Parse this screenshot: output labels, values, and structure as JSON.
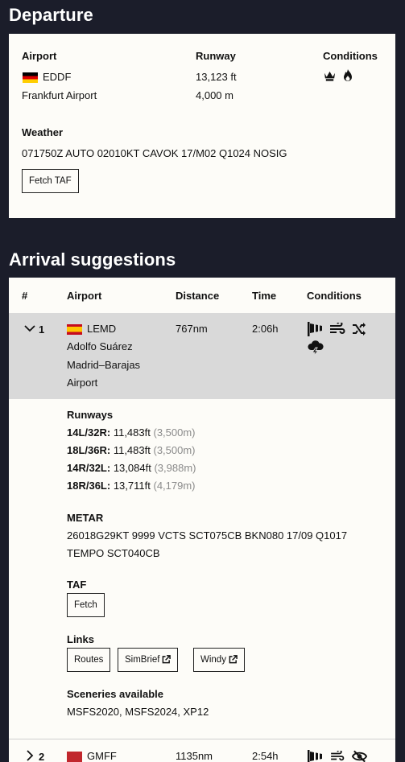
{
  "departure": {
    "section_title": "Departure",
    "airport_label": "Airport",
    "icao": "EDDF",
    "airport_name": "Frankfurt Airport",
    "runway_label": "Runway",
    "runway_ft": "13,123 ft",
    "runway_m": "4,000 m",
    "conditions_label": "Conditions",
    "condition_icons": [
      "crown-icon",
      "fire-icon"
    ],
    "weather_label": "Weather",
    "metar": "071750Z AUTO 02010KT CAVOK 17/M02 Q1024 NOSIG",
    "fetch_taf_label": "Fetch TAF"
  },
  "arrivals": {
    "section_title": "Arrival suggestions",
    "headers": {
      "num": "#",
      "airport": "Airport",
      "distance": "Distance",
      "time": "Time",
      "conditions": "Conditions"
    },
    "rows": [
      {
        "num": "1",
        "icao": "LEMD",
        "name_line1": "Adolfo Suárez",
        "name_line2": "Madrid–Barajas",
        "name_line3": "Airport",
        "distance": "767nm",
        "time": "2:06h",
        "condition_icons": [
          "windsock-icon",
          "wind-icon",
          "shuffle-icon",
          "thunderstorm-icon"
        ],
        "expanded": true,
        "details": {
          "runways_label": "Runways",
          "runways": [
            {
              "code": "14L/32R:",
              "ft": "11,483ft",
              "m": "(3,500m)"
            },
            {
              "code": "18L/36R:",
              "ft": "11,483ft",
              "m": "(3,500m)"
            },
            {
              "code": "14R/32L:",
              "ft": "13,084ft",
              "m": "(3,988m)"
            },
            {
              "code": "18R/36L:",
              "ft": "13,711ft",
              "m": "(4,179m)"
            }
          ],
          "metar_label": "METAR",
          "metar_line1": "26018G29KT 9999 VCTS SCT075CB BKN080 17/09 Q1017",
          "metar_line2": "TEMPO SCT040CB",
          "taf_label": "TAF",
          "taf_fetch_label": "Fetch",
          "links_label": "Links",
          "links": [
            "Routes",
            "SimBrief",
            "Windy"
          ],
          "sceneries_label": "Sceneries available",
          "sceneries": "MSFS2020, MSFS2024, XP12"
        }
      },
      {
        "num": "2",
        "icao": "GMFF",
        "distance": "1135nm",
        "time": "2:54h",
        "condition_icons": [
          "windsock-icon",
          "wind-icon",
          "no-visibility-icon"
        ],
        "expanded": false
      }
    ]
  },
  "colors": {
    "background": "#1b1d2a",
    "card": "#fdfcf8",
    "expanded_row": "#d9d9d9",
    "muted_text": "#8a8a8a"
  }
}
